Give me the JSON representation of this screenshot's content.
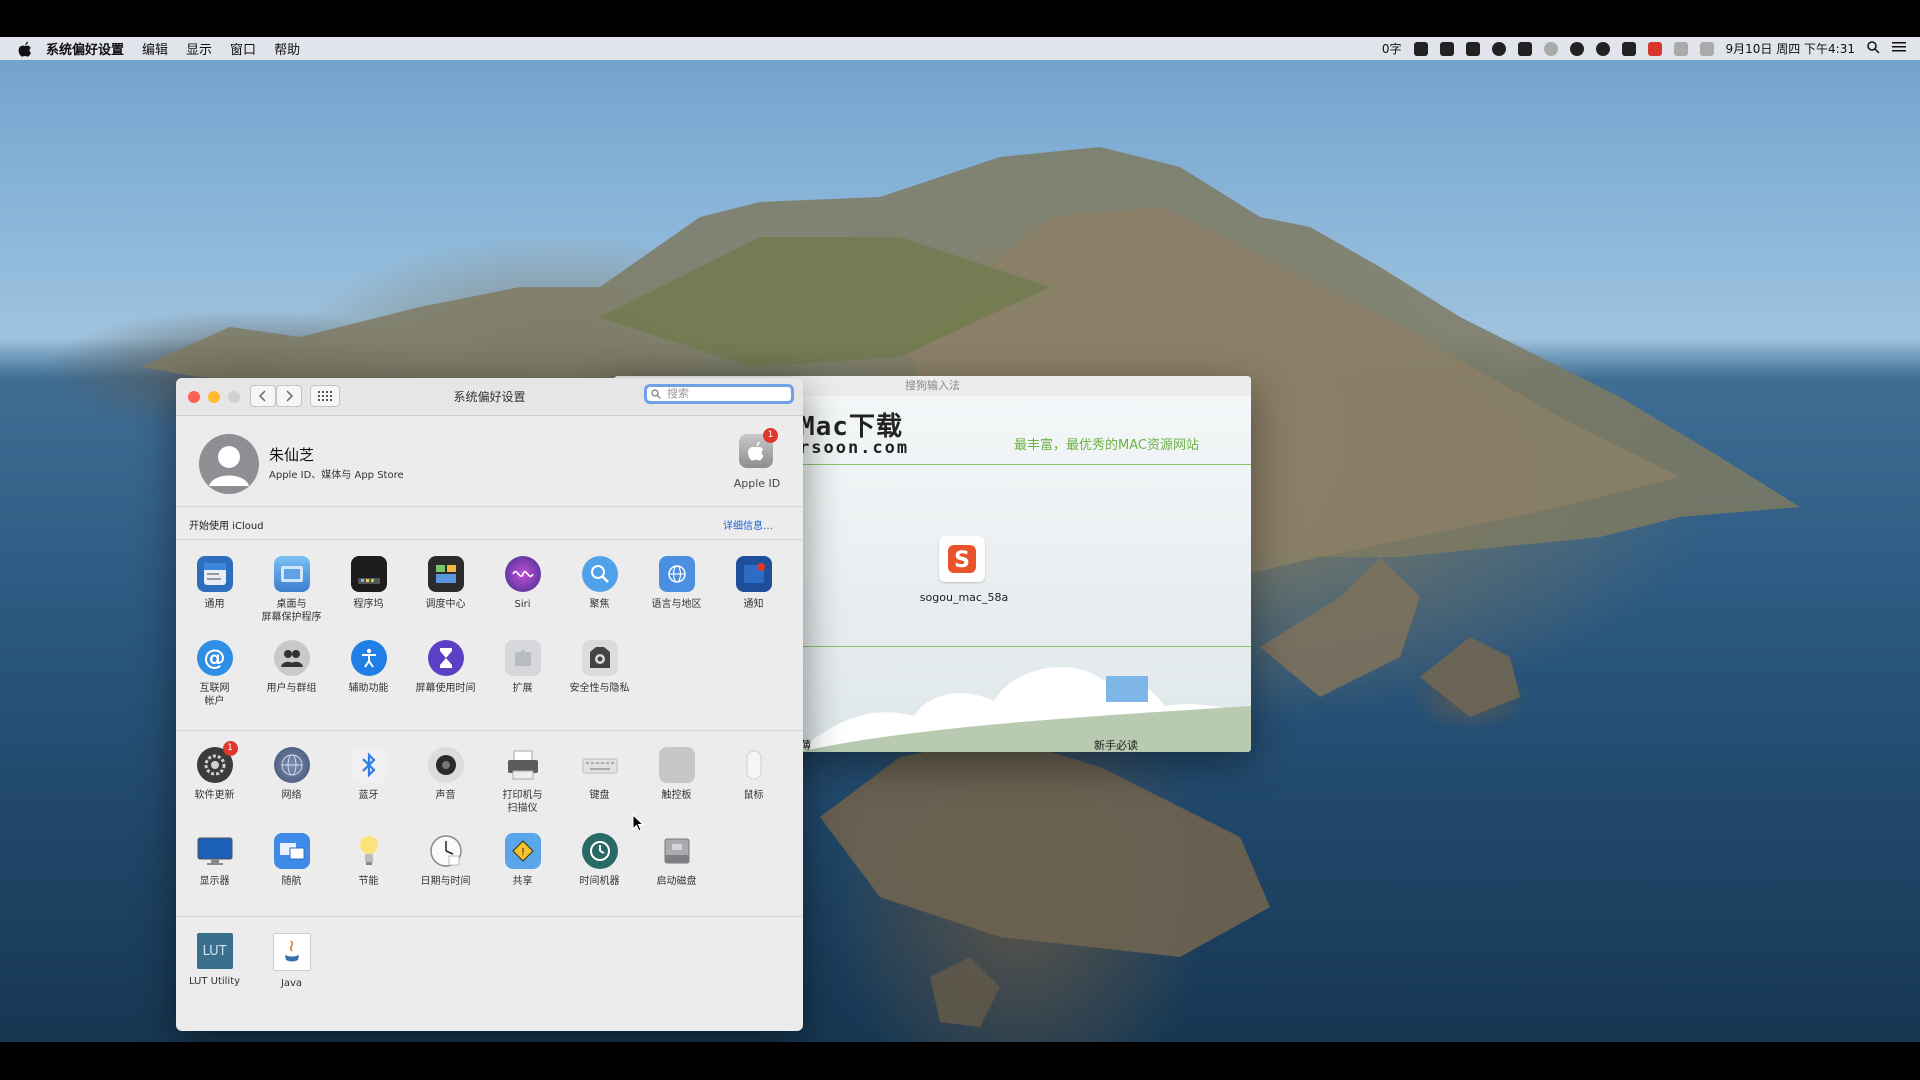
{
  "menubar": {
    "app_name": "系统偏好设置",
    "items": [
      "编辑",
      "显示",
      "窗口",
      "帮助"
    ],
    "input_indicator": "0字",
    "datetime": "9月10日 周四 下午4:31"
  },
  "prefs_window": {
    "title": "系统偏好设置",
    "search_placeholder": "搜索",
    "account": {
      "name": "朱仙芝",
      "subtitle": "Apple ID、媒体与 App Store",
      "apple_id_label": "Apple ID",
      "apple_id_badge": "1"
    },
    "icloud": {
      "label": "开始使用 iCloud",
      "link": "详细信息…"
    },
    "row1": [
      {
        "label": "通用",
        "icon": "general-icon"
      },
      {
        "label": "桌面与\n屏幕保护程序",
        "icon": "desktop-screensaver-icon"
      },
      {
        "label": "程序坞",
        "icon": "dock-icon"
      },
      {
        "label": "调度中心",
        "icon": "mission-control-icon"
      },
      {
        "label": "Siri",
        "icon": "siri-icon"
      },
      {
        "label": "聚焦",
        "icon": "spotlight-icon"
      },
      {
        "label": "语言与地区",
        "icon": "language-region-icon"
      },
      {
        "label": "通知",
        "icon": "notifications-icon"
      }
    ],
    "row2": [
      {
        "label": "互联网\n帐户",
        "icon": "internet-accounts-icon"
      },
      {
        "label": "用户与群组",
        "icon": "users-groups-icon"
      },
      {
        "label": "辅助功能",
        "icon": "accessibility-icon"
      },
      {
        "label": "屏幕使用时间",
        "icon": "screen-time-icon"
      },
      {
        "label": "扩展",
        "icon": "extensions-icon"
      },
      {
        "label": "安全性与隐私",
        "icon": "security-privacy-icon"
      }
    ],
    "row3": [
      {
        "label": "软件更新",
        "icon": "software-update-icon",
        "badge": "1"
      },
      {
        "label": "网络",
        "icon": "network-icon"
      },
      {
        "label": "蓝牙",
        "icon": "bluetooth-icon"
      },
      {
        "label": "声音",
        "icon": "sound-icon"
      },
      {
        "label": "打印机与\n扫描仪",
        "icon": "printers-scanners-icon"
      },
      {
        "label": "键盘",
        "icon": "keyboard-icon"
      },
      {
        "label": "触控板",
        "icon": "trackpad-icon"
      },
      {
        "label": "鼠标",
        "icon": "mouse-icon"
      }
    ],
    "row4": [
      {
        "label": "显示器",
        "icon": "displays-icon"
      },
      {
        "label": "随航",
        "icon": "sidecar-icon"
      },
      {
        "label": "节能",
        "icon": "energy-saver-icon"
      },
      {
        "label": "日期与时间",
        "icon": "date-time-icon"
      },
      {
        "label": "共享",
        "icon": "sharing-icon"
      },
      {
        "label": "时间机器",
        "icon": "time-machine-icon"
      },
      {
        "label": "启动磁盘",
        "icon": "startup-disk-icon"
      }
    ],
    "row5": [
      {
        "label": "LUT Utility",
        "icon": "lut-utility-icon"
      },
      {
        "label": "Java",
        "icon": "java-icon"
      }
    ]
  },
  "sogou_window": {
    "title": "搜狗输入法",
    "banner_title": "Mac下载",
    "banner_url": "rsoon.com",
    "slogan": "最丰富，最优秀的MAC资源网站",
    "file_label": "sogou_mac_58a",
    "left_bottom_label": "薄",
    "newbie_label": "新手必读"
  },
  "colors": {
    "accent": "#1a64d6",
    "badge": "#e0372c",
    "slogan_green": "#6cb245"
  }
}
